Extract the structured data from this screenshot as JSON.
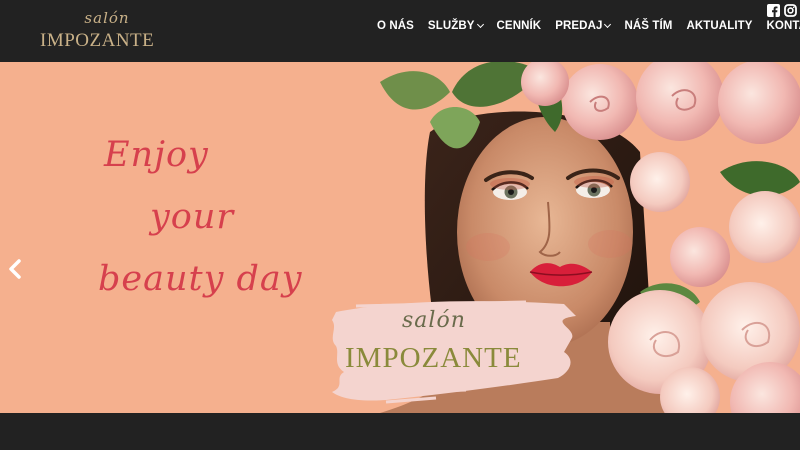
{
  "header": {
    "logo": {
      "script": "salón",
      "name": "IMPOZANTE"
    },
    "nav": [
      {
        "label": "O NÁS",
        "dropdown": false
      },
      {
        "label": "SLUŽBY",
        "dropdown": true
      },
      {
        "label": "CENNÍK",
        "dropdown": false
      },
      {
        "label": "PREDAJ",
        "dropdown": true
      },
      {
        "label": "NÁŠ TÍM",
        "dropdown": false
      },
      {
        "label": "AKTUALITY",
        "dropdown": false
      },
      {
        "label": "KONTAKT",
        "dropdown": false
      }
    ],
    "social": [
      "facebook-icon",
      "instagram-icon"
    ]
  },
  "hero": {
    "tagline": [
      "Enjoy",
      "your",
      "beauty day"
    ],
    "stamp_script": "salón",
    "stamp_name": "IMPOZANTE",
    "colors": {
      "background": "#f5b08e",
      "tagline": "#d6404d"
    }
  },
  "colors": {
    "header_bg": "#222222",
    "logo_gold": "#c9b188",
    "nav_text": "#ffffff"
  }
}
